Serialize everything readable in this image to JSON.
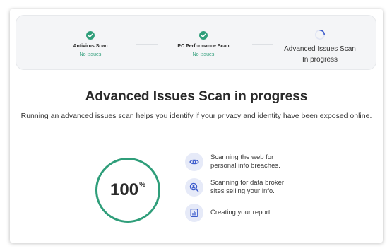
{
  "steps": [
    {
      "title": "Antivirus Scan",
      "status": "No issues",
      "state": "done"
    },
    {
      "title": "PC Performance Scan",
      "status": "No issues",
      "state": "done"
    },
    {
      "title": "Advanced Issues Scan",
      "status": "In progress",
      "state": "active"
    }
  ],
  "main": {
    "heading": "Advanced Issues Scan in progress",
    "description": "Running an advanced issues scan helps you identify if your privacy and identity have been exposed online.",
    "progress_value": "100",
    "progress_unit": "%"
  },
  "items": [
    {
      "icon": "eye-icon",
      "line1": "Scanning the web for",
      "line2": "personal info breaches."
    },
    {
      "icon": "search-person-icon",
      "line1": "Scanning for data broker",
      "line2": "sites selling your info."
    },
    {
      "icon": "report-chart-icon",
      "line1": "Creating your report.",
      "line2": ""
    }
  ],
  "colors": {
    "accent": "#2f9e7a",
    "icon_bg": "#e6eaf8",
    "icon_fg": "#3d5ccc"
  }
}
